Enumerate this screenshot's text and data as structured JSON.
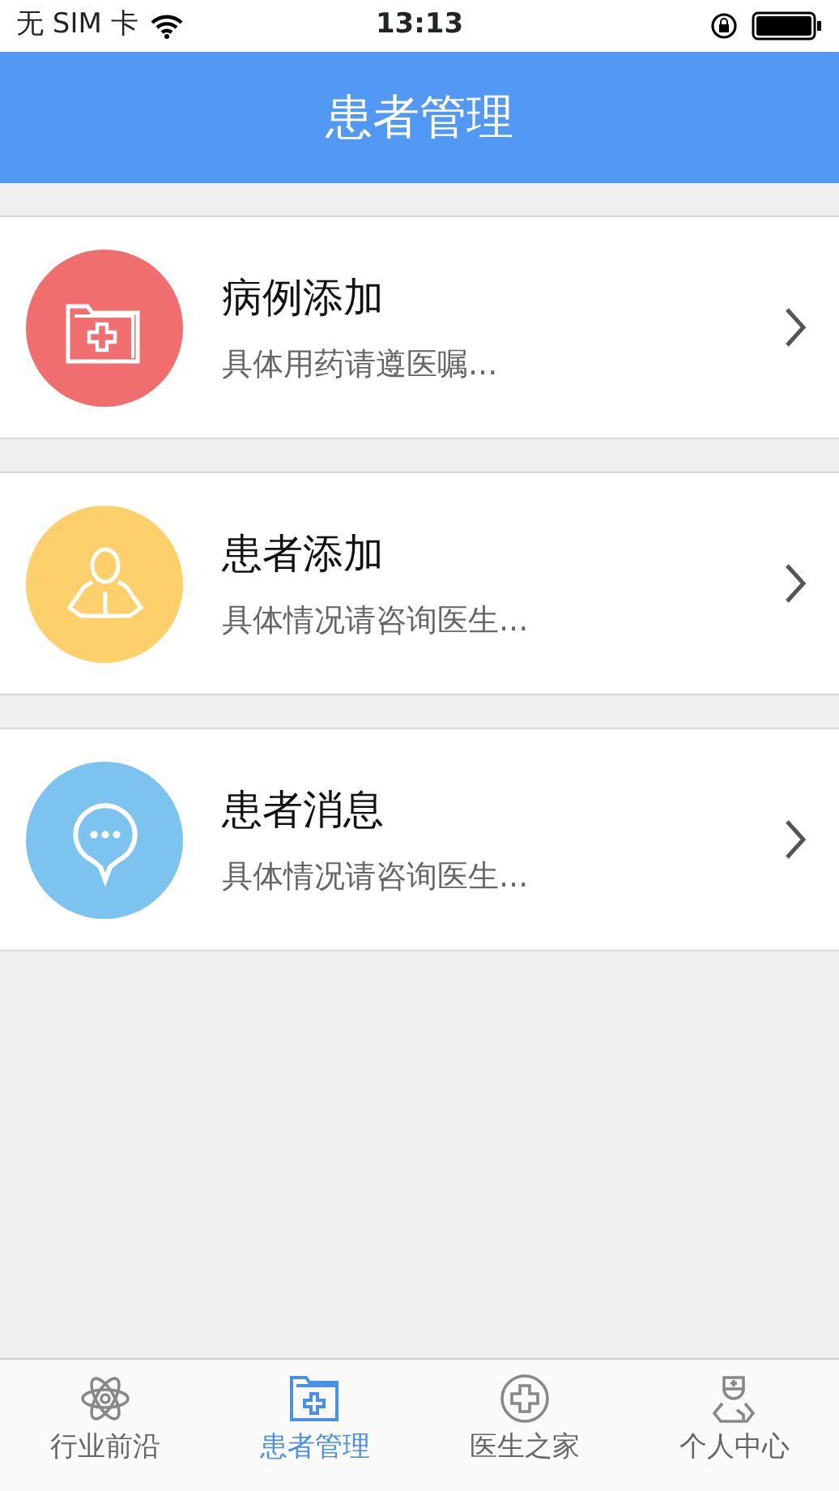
{
  "status_bar": {
    "carrier": "无 SIM 卡",
    "time": "13:13"
  },
  "nav": {
    "title": "患者管理"
  },
  "items": [
    {
      "kind": "folder",
      "color": "#f06e6e",
      "title": "病例添加",
      "subtitle": "具体用药请遵医嘱..."
    },
    {
      "kind": "person",
      "color": "#fdd06b",
      "title": "患者添加",
      "subtitle": "具体情况请咨询医生..."
    },
    {
      "kind": "chat",
      "color": "#7cc3ef",
      "title": "患者消息",
      "subtitle": "具体情况请咨询医生..."
    }
  ],
  "tabs": [
    {
      "kind": "atom",
      "label": "行业前沿",
      "selected": false
    },
    {
      "kind": "folder",
      "label": "患者管理",
      "selected": true
    },
    {
      "kind": "cross",
      "label": "医生之家",
      "selected": false
    },
    {
      "kind": "doctor",
      "label": "个人中心",
      "selected": false
    }
  ]
}
